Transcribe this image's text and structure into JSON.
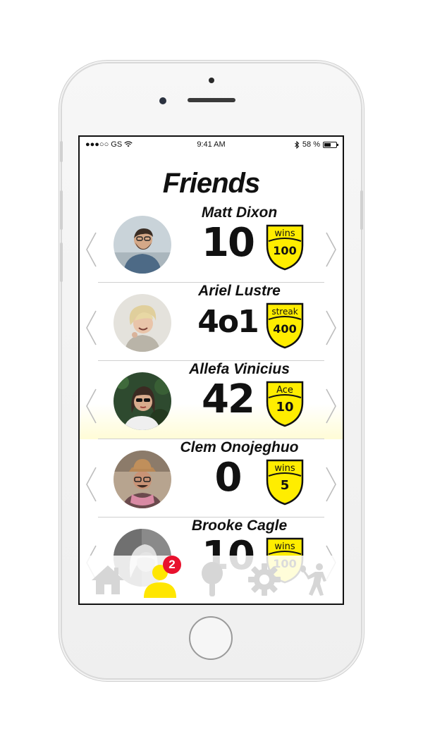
{
  "status_bar": {
    "carrier": "●●●○○ GS",
    "time": "9:41 AM",
    "battery": "58 %",
    "battery_level": 0.58
  },
  "page": {
    "title": "Friends"
  },
  "friends": [
    {
      "name": "Matt Dixon",
      "score": "10",
      "badge_label": "wins",
      "badge_value": "100"
    },
    {
      "name": "Ariel Lustre",
      "score": "4o1",
      "badge_label": "streak",
      "badge_value": "400"
    },
    {
      "name": "Allefa Vinicius",
      "score": "42",
      "badge_label": "Ace",
      "badge_value": "10",
      "highlighted": true
    },
    {
      "name": "Clem Onojeghuo",
      "score": "0",
      "badge_label": "wins",
      "badge_value": "5"
    },
    {
      "name": "Brooke Cagle",
      "score": "10",
      "badge_label": "wins",
      "badge_value": "100"
    }
  ],
  "tab_bar": {
    "items": [
      {
        "icon": "home-icon",
        "active": false
      },
      {
        "icon": "friends-icon",
        "active": true,
        "notification_count": "2"
      },
      {
        "icon": "paddle-icon",
        "active": false
      },
      {
        "icon": "gear-icon",
        "active": false
      },
      {
        "icon": "player-icon",
        "active": false
      }
    ]
  },
  "colors": {
    "accent": "#ffe600",
    "badge_fill": "#ffed00",
    "notification": "#e8112d",
    "inactive_icon": "#d6d6d6",
    "text": "#111111"
  }
}
